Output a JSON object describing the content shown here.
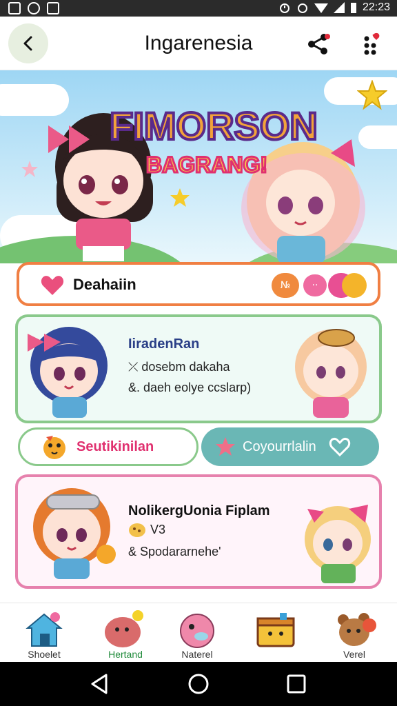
{
  "status_bar": {
    "time": "22:23"
  },
  "app_bar": {
    "title": "Ingarenesia",
    "back_icon": "chevron-left-icon",
    "share_icon": "share-icon",
    "more_icon": "more-vert-icon"
  },
  "banner": {
    "title_line1": "FIMORSON",
    "title_line2": "BAGRANG!"
  },
  "search": {
    "label": "Deahaiin",
    "badges": [
      "№",
      "··",
      ""
    ]
  },
  "card_1": {
    "title": "IiradenRan",
    "line1": "⤫ dosebm dakaha",
    "line2": "&. daeh eolye ccslarp)"
  },
  "actions": {
    "left_label": "Seutikinilan",
    "right_label": "Coyourrlalin"
  },
  "card_2": {
    "title": "NolikergUonia Fiplam",
    "line1": "V3",
    "line2": "& Spodararnehe'"
  },
  "bottom_nav": {
    "items": [
      {
        "label": "Shoelet",
        "icon": "home-icon"
      },
      {
        "label": "Hertand",
        "icon": "elephant-icon"
      },
      {
        "label": "Naterel",
        "icon": "bird-icon"
      },
      {
        "label": "",
        "icon": "gift-box-icon"
      },
      {
        "label": "Verel",
        "icon": "bear-icon"
      }
    ],
    "active_index": 1
  },
  "colors": {
    "accent_orange": "#f07f43",
    "accent_green": "#8ac98b",
    "accent_pink": "#e681ad",
    "teal": "#6ab7b5",
    "title_pink": "#e0306f",
    "title_navy": "#2a3f87"
  }
}
